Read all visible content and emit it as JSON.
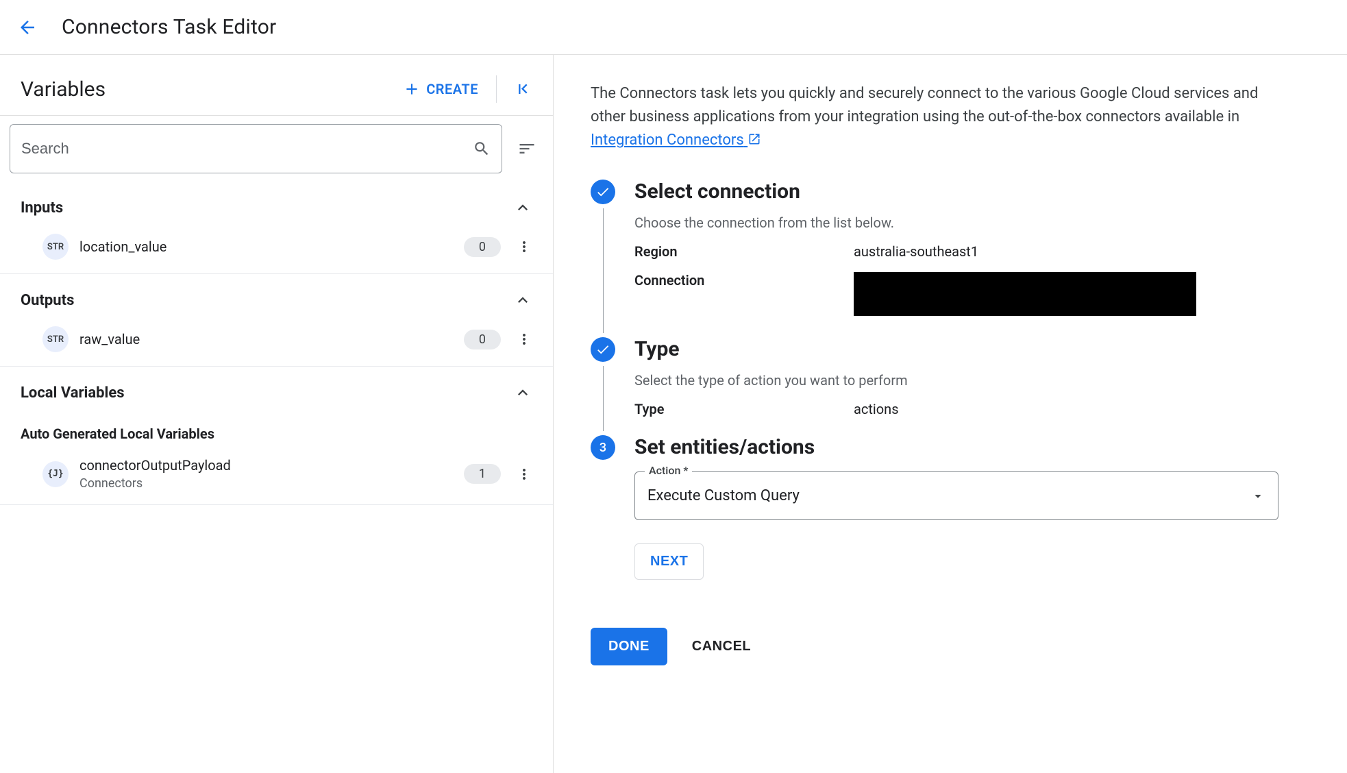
{
  "header": {
    "title": "Connectors Task Editor"
  },
  "left": {
    "title": "Variables",
    "create_label": "CREATE",
    "search_placeholder": "Search",
    "sections": {
      "inputs": {
        "title": "Inputs",
        "items": [
          {
            "type": "STR",
            "name": "location_value",
            "count": "0"
          }
        ]
      },
      "outputs": {
        "title": "Outputs",
        "items": [
          {
            "type": "STR",
            "name": "raw_value",
            "count": "0"
          }
        ]
      },
      "local": {
        "title": "Local Variables",
        "subhead": "Auto Generated Local Variables",
        "items": [
          {
            "type": "{J}",
            "name": "connectorOutputPayload",
            "sub": "Connectors",
            "count": "1"
          }
        ]
      }
    }
  },
  "right": {
    "intro_text": "The Connectors task lets you quickly and securely connect to the various Google Cloud services and other business applications from your integration using the out-of-the-box connectors available in ",
    "intro_link": "Integration Connectors",
    "steps": {
      "s1": {
        "title": "Select connection",
        "sub": "Choose the connection from the list below.",
        "region_k": "Region",
        "region_v": "australia-southeast1",
        "connection_k": "Connection"
      },
      "s2": {
        "title": "Type",
        "sub": "Select the type of action you want to perform",
        "type_k": "Type",
        "type_v": "actions"
      },
      "s3": {
        "badge": "3",
        "title": "Set entities/actions",
        "action_label": "Action *",
        "action_value": "Execute Custom Query",
        "next": "NEXT"
      }
    },
    "done": "DONE",
    "cancel": "CANCEL"
  }
}
